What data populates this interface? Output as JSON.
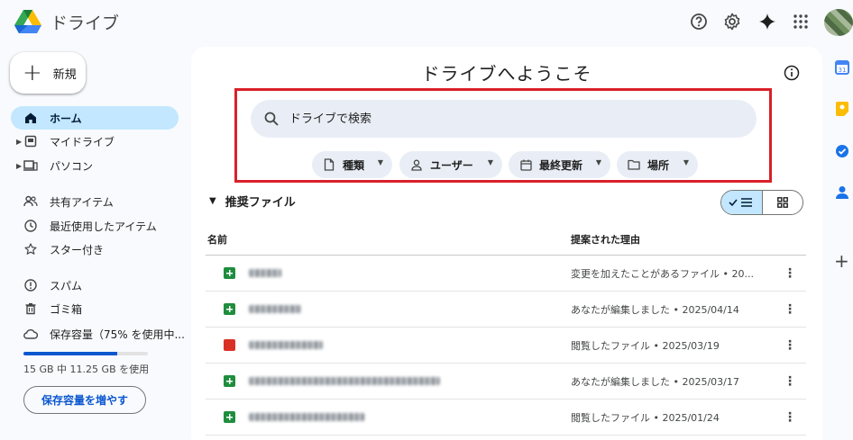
{
  "app": {
    "title": "ドライブ"
  },
  "header_icons": [
    "help-icon",
    "settings-icon",
    "gemini-icon",
    "apps-grid-icon"
  ],
  "sidebar": {
    "new_label": "新規",
    "items": [
      {
        "label": "ホーム",
        "icon": "home-icon",
        "active": true
      },
      {
        "label": "マイドライブ",
        "icon": "my-drive-icon"
      },
      {
        "label": "パソコン",
        "icon": "computer-icon"
      },
      {
        "label": "共有アイテム",
        "icon": "shared-icon"
      },
      {
        "label": "最近使用したアイテム",
        "icon": "clock-icon"
      },
      {
        "label": "スター付き",
        "icon": "star-icon"
      },
      {
        "label": "スパム",
        "icon": "spam-icon"
      },
      {
        "label": "ゴミ箱",
        "icon": "trash-icon"
      },
      {
        "label": "保存容量（75% を使用中...",
        "icon": "cloud-icon"
      }
    ],
    "storage": {
      "used_fraction": 0.75,
      "text": "15 GB 中 11.25 GB を使用",
      "button": "保存容量を増やす"
    }
  },
  "main": {
    "title": "ドライブへようこそ",
    "search_placeholder": "ドライブで検索",
    "chips": [
      {
        "label": "種類",
        "icon": "file-icon"
      },
      {
        "label": "ユーザー",
        "icon": "person-icon"
      },
      {
        "label": "最終更新",
        "icon": "calendar-icon"
      },
      {
        "label": "場所",
        "icon": "folder-icon"
      }
    ],
    "section_title": "推奨ファイル",
    "columns": {
      "name": "名前",
      "reason": "提案された理由"
    },
    "files": [
      {
        "type": "sheets",
        "reason": "変更を加えたことがあるファイル • 20..."
      },
      {
        "type": "sheets",
        "reason": "あなたが編集しました • 2025/04/14"
      },
      {
        "type": "video",
        "reason": "閲覧したファイル • 2025/03/19"
      },
      {
        "type": "sheets",
        "reason": "あなたが編集しました • 2025/03/17"
      },
      {
        "type": "sheets",
        "reason": "閲覧したファイル • 2025/01/24"
      }
    ]
  },
  "colors": {
    "accent": "#0b57d0",
    "active_nav": "#c2e7ff",
    "sheets": "#1e8e3e",
    "video": "#d93025",
    "highlight_box": "#d9202a"
  }
}
